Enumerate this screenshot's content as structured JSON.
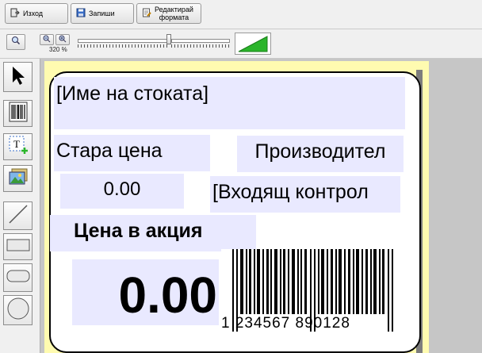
{
  "toolbar": {
    "exit_label": "Изход",
    "save_label": "Запиши",
    "edit_format_line1": "Редактирай",
    "edit_format_line2": "формата"
  },
  "zoom": {
    "level_text": "320 %"
  },
  "label": {
    "product_name": "[Име на стоката]",
    "old_price_label": "Стара цена",
    "old_price_value": "0.00",
    "manufacturer": "Производител",
    "incoming_control": "[Входящ контрол",
    "promo_price_label": "Цена в акция",
    "promo_price_value": "0.00",
    "barcode_text": "1 234567 890128"
  },
  "colors": {
    "field_bg": "#e9e9ff",
    "label_bg": "#fffbb0",
    "volume_green": "#2bb52b"
  }
}
